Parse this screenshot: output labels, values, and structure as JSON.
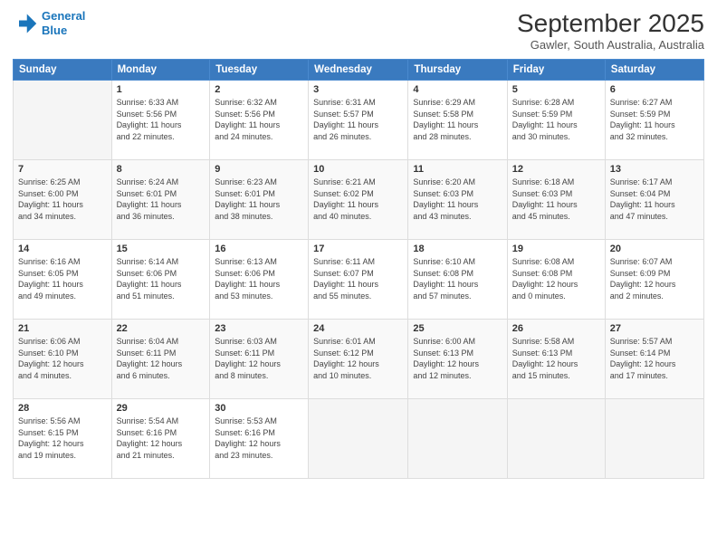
{
  "header": {
    "logo_line1": "General",
    "logo_line2": "Blue",
    "title": "September 2025",
    "subtitle": "Gawler, South Australia, Australia"
  },
  "days_of_week": [
    "Sunday",
    "Monday",
    "Tuesday",
    "Wednesday",
    "Thursday",
    "Friday",
    "Saturday"
  ],
  "weeks": [
    [
      {
        "day": "",
        "info": ""
      },
      {
        "day": "1",
        "info": "Sunrise: 6:33 AM\nSunset: 5:56 PM\nDaylight: 11 hours\nand 22 minutes."
      },
      {
        "day": "2",
        "info": "Sunrise: 6:32 AM\nSunset: 5:56 PM\nDaylight: 11 hours\nand 24 minutes."
      },
      {
        "day": "3",
        "info": "Sunrise: 6:31 AM\nSunset: 5:57 PM\nDaylight: 11 hours\nand 26 minutes."
      },
      {
        "day": "4",
        "info": "Sunrise: 6:29 AM\nSunset: 5:58 PM\nDaylight: 11 hours\nand 28 minutes."
      },
      {
        "day": "5",
        "info": "Sunrise: 6:28 AM\nSunset: 5:59 PM\nDaylight: 11 hours\nand 30 minutes."
      },
      {
        "day": "6",
        "info": "Sunrise: 6:27 AM\nSunset: 5:59 PM\nDaylight: 11 hours\nand 32 minutes."
      }
    ],
    [
      {
        "day": "7",
        "info": "Sunrise: 6:25 AM\nSunset: 6:00 PM\nDaylight: 11 hours\nand 34 minutes."
      },
      {
        "day": "8",
        "info": "Sunrise: 6:24 AM\nSunset: 6:01 PM\nDaylight: 11 hours\nand 36 minutes."
      },
      {
        "day": "9",
        "info": "Sunrise: 6:23 AM\nSunset: 6:01 PM\nDaylight: 11 hours\nand 38 minutes."
      },
      {
        "day": "10",
        "info": "Sunrise: 6:21 AM\nSunset: 6:02 PM\nDaylight: 11 hours\nand 40 minutes."
      },
      {
        "day": "11",
        "info": "Sunrise: 6:20 AM\nSunset: 6:03 PM\nDaylight: 11 hours\nand 43 minutes."
      },
      {
        "day": "12",
        "info": "Sunrise: 6:18 AM\nSunset: 6:03 PM\nDaylight: 11 hours\nand 45 minutes."
      },
      {
        "day": "13",
        "info": "Sunrise: 6:17 AM\nSunset: 6:04 PM\nDaylight: 11 hours\nand 47 minutes."
      }
    ],
    [
      {
        "day": "14",
        "info": "Sunrise: 6:16 AM\nSunset: 6:05 PM\nDaylight: 11 hours\nand 49 minutes."
      },
      {
        "day": "15",
        "info": "Sunrise: 6:14 AM\nSunset: 6:06 PM\nDaylight: 11 hours\nand 51 minutes."
      },
      {
        "day": "16",
        "info": "Sunrise: 6:13 AM\nSunset: 6:06 PM\nDaylight: 11 hours\nand 53 minutes."
      },
      {
        "day": "17",
        "info": "Sunrise: 6:11 AM\nSunset: 6:07 PM\nDaylight: 11 hours\nand 55 minutes."
      },
      {
        "day": "18",
        "info": "Sunrise: 6:10 AM\nSunset: 6:08 PM\nDaylight: 11 hours\nand 57 minutes."
      },
      {
        "day": "19",
        "info": "Sunrise: 6:08 AM\nSunset: 6:08 PM\nDaylight: 12 hours\nand 0 minutes."
      },
      {
        "day": "20",
        "info": "Sunrise: 6:07 AM\nSunset: 6:09 PM\nDaylight: 12 hours\nand 2 minutes."
      }
    ],
    [
      {
        "day": "21",
        "info": "Sunrise: 6:06 AM\nSunset: 6:10 PM\nDaylight: 12 hours\nand 4 minutes."
      },
      {
        "day": "22",
        "info": "Sunrise: 6:04 AM\nSunset: 6:11 PM\nDaylight: 12 hours\nand 6 minutes."
      },
      {
        "day": "23",
        "info": "Sunrise: 6:03 AM\nSunset: 6:11 PM\nDaylight: 12 hours\nand 8 minutes."
      },
      {
        "day": "24",
        "info": "Sunrise: 6:01 AM\nSunset: 6:12 PM\nDaylight: 12 hours\nand 10 minutes."
      },
      {
        "day": "25",
        "info": "Sunrise: 6:00 AM\nSunset: 6:13 PM\nDaylight: 12 hours\nand 12 minutes."
      },
      {
        "day": "26",
        "info": "Sunrise: 5:58 AM\nSunset: 6:13 PM\nDaylight: 12 hours\nand 15 minutes."
      },
      {
        "day": "27",
        "info": "Sunrise: 5:57 AM\nSunset: 6:14 PM\nDaylight: 12 hours\nand 17 minutes."
      }
    ],
    [
      {
        "day": "28",
        "info": "Sunrise: 5:56 AM\nSunset: 6:15 PM\nDaylight: 12 hours\nand 19 minutes."
      },
      {
        "day": "29",
        "info": "Sunrise: 5:54 AM\nSunset: 6:16 PM\nDaylight: 12 hours\nand 21 minutes."
      },
      {
        "day": "30",
        "info": "Sunrise: 5:53 AM\nSunset: 6:16 PM\nDaylight: 12 hours\nand 23 minutes."
      },
      {
        "day": "",
        "info": ""
      },
      {
        "day": "",
        "info": ""
      },
      {
        "day": "",
        "info": ""
      },
      {
        "day": "",
        "info": ""
      }
    ]
  ]
}
